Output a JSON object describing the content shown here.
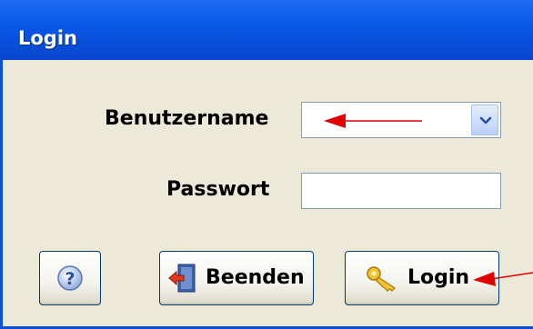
{
  "window": {
    "title": "Login"
  },
  "form": {
    "username_label": "Benutzername",
    "username_value": "",
    "password_label": "Passwort",
    "password_value": ""
  },
  "buttons": {
    "help_icon": "question-icon",
    "exit_label": "Beenden",
    "exit_icon": "exit-door-icon",
    "login_label": "Login",
    "login_icon": "key-icon"
  },
  "annotations": {
    "arrow_color": "#e00000"
  },
  "colors": {
    "titlebar": "#0a58e8",
    "window_bg": "#ece9d8",
    "button_border": "#003c74"
  }
}
